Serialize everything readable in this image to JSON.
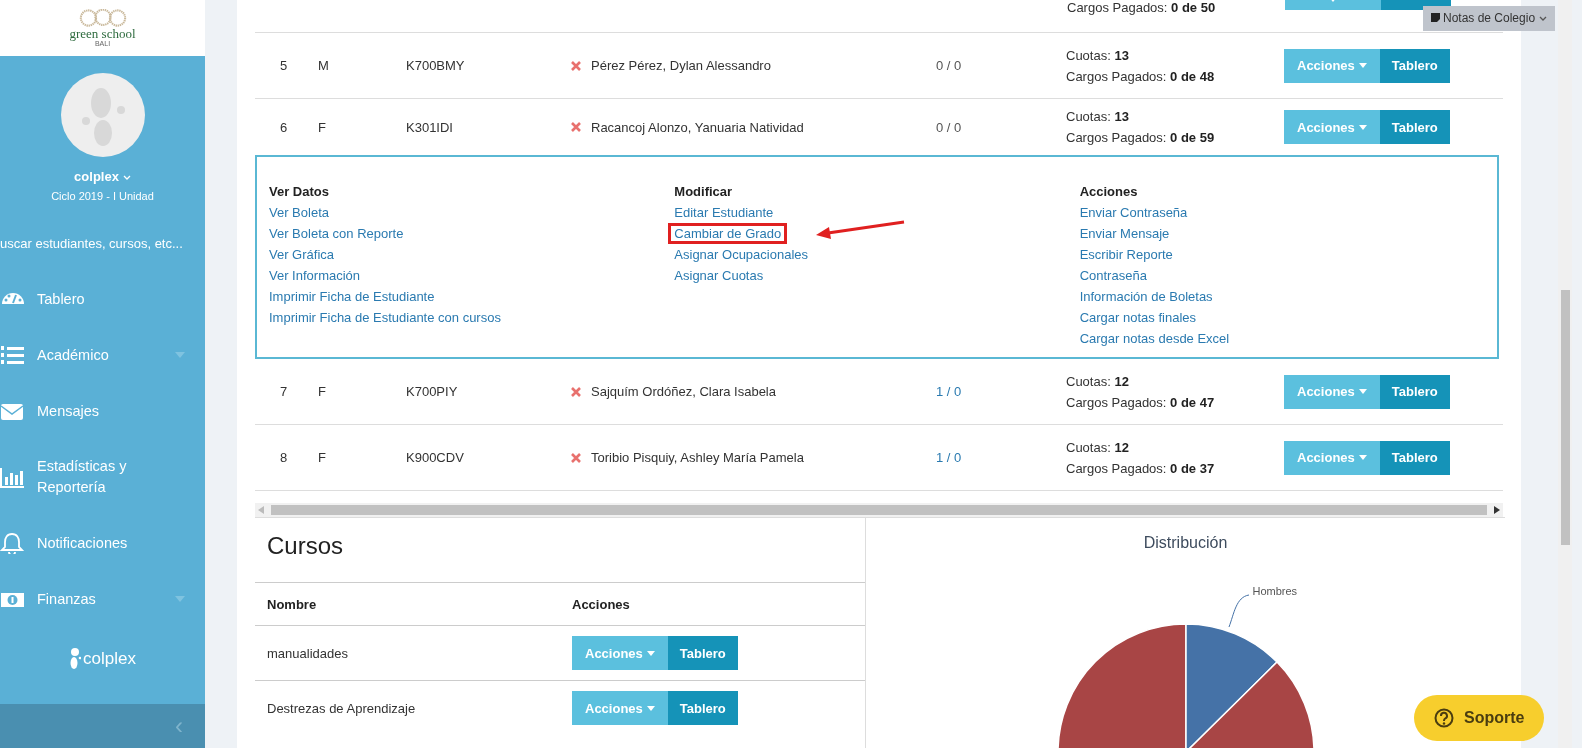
{
  "brand": {
    "name": "green school",
    "sub": "BALI"
  },
  "user": {
    "name": "colplex",
    "cycle": "Ciclo 2019 - I Unidad"
  },
  "search": {
    "placeholder": "uscar estudiantes, cursos, etc..."
  },
  "nav": [
    {
      "label": "Tablero",
      "expandable": false
    },
    {
      "label": "Académico",
      "expandable": true
    },
    {
      "label": "Mensajes",
      "expandable": false
    },
    {
      "label": "Estadísticas y Reportería",
      "expandable": false
    },
    {
      "label": "Notificaciones",
      "expandable": false
    },
    {
      "label": "Finanzas",
      "expandable": true
    }
  ],
  "footer_logo": "colplex",
  "collapse": "‹",
  "notes_menu": {
    "label": "Notas de Colegio"
  },
  "students": {
    "top_row": {
      "cargos_label": "Cargos Pagados:",
      "cargos": "0 de 50"
    },
    "rows": [
      {
        "number": "5",
        "sex": "M",
        "code": "K700BMY",
        "name": "Pérez Pérez, Dylan Alessandro",
        "ratio": "0 / 0",
        "ratio_link": false,
        "cuotas_label": "Cuotas:",
        "cuotas": "13",
        "cargos_label": "Cargos Pagados:",
        "cargos": "0 de 48",
        "actions": "Acciones",
        "board": "Tablero"
      },
      {
        "number": "6",
        "sex": "F",
        "code": "K301IDI",
        "name": "Racancoj Alonzo, Yanuaria Natividad",
        "ratio": "0 / 0",
        "ratio_link": false,
        "cuotas_label": "Cuotas:",
        "cuotas": "13",
        "cargos_label": "Cargos Pagados:",
        "cargos": "0 de 59",
        "actions": "Acciones",
        "board": "Tablero",
        "menu": [
          {
            "title": "Ver Datos",
            "links": [
              {
                "label": "Ver Boleta",
                "highlighted": false
              },
              {
                "label": "Ver Boleta con Reporte",
                "highlighted": false
              },
              {
                "label": "Ver Gráfica",
                "highlighted": false
              },
              {
                "label": "Ver Información",
                "highlighted": false
              },
              {
                "label": "Imprimir Ficha de Estudiante",
                "highlighted": false
              },
              {
                "label": "Imprimir Ficha de Estudiante con cursos",
                "highlighted": false
              }
            ]
          },
          {
            "title": "Modificar",
            "links": [
              {
                "label": "Editar Estudiante",
                "highlighted": false
              },
              {
                "label": "Cambiar de Grado",
                "highlighted": true
              },
              {
                "label": "Asignar Ocupacionales",
                "highlighted": false
              },
              {
                "label": "Asignar Cuotas",
                "highlighted": false
              }
            ]
          },
          {
            "title": "Acciones",
            "links": [
              {
                "label": "Enviar Contraseña",
                "highlighted": false
              },
              {
                "label": "Enviar Mensaje",
                "highlighted": false
              },
              {
                "label": "Escribir Reporte",
                "highlighted": false
              },
              {
                "label": "Contraseña",
                "highlighted": false
              },
              {
                "label": "Información de Boletas",
                "highlighted": false
              },
              {
                "label": "Cargar notas finales",
                "highlighted": false
              },
              {
                "label": "Cargar notas desde Excel",
                "highlighted": false
              }
            ]
          }
        ]
      },
      {
        "number": "7",
        "sex": "F",
        "code": "K700PIY",
        "name": "Sajquím Ordóñez, Clara Isabela",
        "ratio": "1 / 0",
        "ratio_link": true,
        "cuotas_label": "Cuotas:",
        "cuotas": "12",
        "cargos_label": "Cargos Pagados:",
        "cargos": "0 de 47",
        "actions": "Acciones",
        "board": "Tablero"
      },
      {
        "number": "8",
        "sex": "F",
        "code": "K900CDV",
        "name": "Toribio Pisquiy, Ashley María Pamela",
        "ratio": "1 / 0",
        "ratio_link": true,
        "cuotas_label": "Cuotas:",
        "cuotas": "12",
        "cargos_label": "Cargos Pagados:",
        "cargos": "0 de 37",
        "actions": "Acciones",
        "board": "Tablero"
      }
    ]
  },
  "courses": {
    "title": "Cursos",
    "columns": [
      "Nombre",
      "Acciones"
    ],
    "rows": [
      {
        "name": "manualidades",
        "actions": "Acciones",
        "board": "Tablero"
      },
      {
        "name": "Destrezas de Aprendizaje",
        "actions": "Acciones",
        "board": "Tablero"
      }
    ]
  },
  "chart": {
    "title": "Distribución",
    "label": "Hombres"
  },
  "support": {
    "label": "Soporte"
  }
}
